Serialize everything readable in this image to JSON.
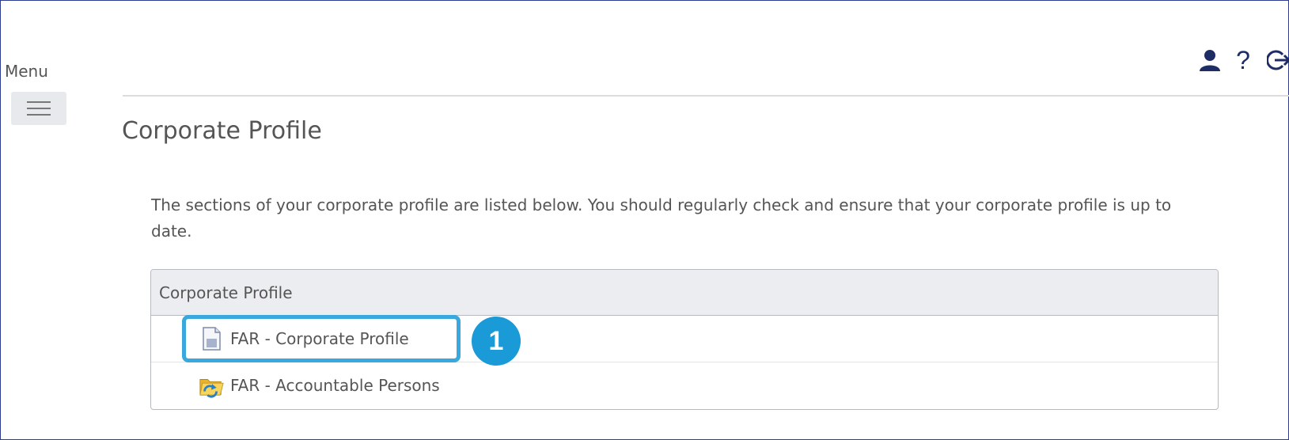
{
  "header": {
    "icons": [
      "user-icon",
      "help-icon",
      "logout-icon"
    ],
    "help_glyph": "?"
  },
  "menu": {
    "label": "Menu",
    "icon": "hamburger-icon"
  },
  "page": {
    "title": "Corporate Profile",
    "intro": "The sections of your corporate profile are listed below. You should regularly check and ensure that your corporate profile is up to date."
  },
  "panel": {
    "header": "Corporate Profile",
    "items": [
      {
        "label": "FAR - Corporate Profile",
        "icon": "document-icon"
      },
      {
        "label": "FAR - Accountable Persons",
        "icon": "folder-icon"
      }
    ]
  },
  "annotation": {
    "callout_number": "1"
  },
  "colors": {
    "frame_border": "#2e3d8f",
    "header_icon": "#1f2d66",
    "highlight": "#3aa8dc",
    "callout": "#1a9ad6",
    "panel_header_bg": "#ecedf1"
  }
}
